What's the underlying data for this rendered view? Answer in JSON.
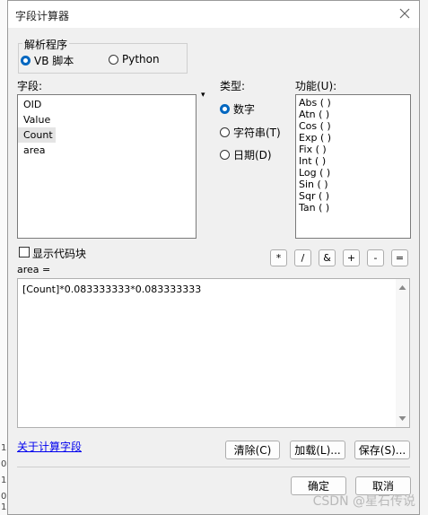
{
  "dialog": {
    "title": "字段计算器",
    "close_glyph": "✕"
  },
  "parser": {
    "legend": "解析程序",
    "options": [
      {
        "label": "VB 脚本",
        "selected": true
      },
      {
        "label": "Python",
        "selected": false
      }
    ]
  },
  "fields": {
    "label": "字段:",
    "items": [
      "OID",
      "Value",
      "Count",
      "area"
    ],
    "selected": "Count"
  },
  "type": {
    "label": "类型:",
    "options": [
      {
        "label": "数字",
        "selected": true
      },
      {
        "label": "字符串(T)",
        "selected": false
      },
      {
        "label": "日期(D)",
        "selected": false
      }
    ]
  },
  "functions": {
    "label": "功能(U):",
    "items": [
      "Abs ( )",
      "Atn ( )",
      "Cos ( )",
      "Exp ( )",
      "Fix ( )",
      "Int ( )",
      "Log ( )",
      "Sin ( )",
      "Sqr ( )",
      "Tan ( )"
    ]
  },
  "show_codeblock": {
    "label": "显示代码块",
    "checked": false
  },
  "operators": [
    "*",
    "/",
    "&",
    "+",
    "-",
    "="
  ],
  "expression": {
    "label": "area =",
    "value": "[Count]*0.083333333*0.083333333"
  },
  "help_link": "关于计算字段",
  "buttons": {
    "clear": "清除(C)",
    "load": "加载(L)...",
    "save": "保存(S)...",
    "ok": "确定",
    "cancel": "取消"
  },
  "background_ticks": [
    "1",
    "0",
    "1",
    "0",
    "1"
  ],
  "watermark": "CSDN @星石传说",
  "colors": {
    "accent": "#0067c0",
    "link": "#0000ee",
    "dialog_bg": "#f0f0f0"
  }
}
